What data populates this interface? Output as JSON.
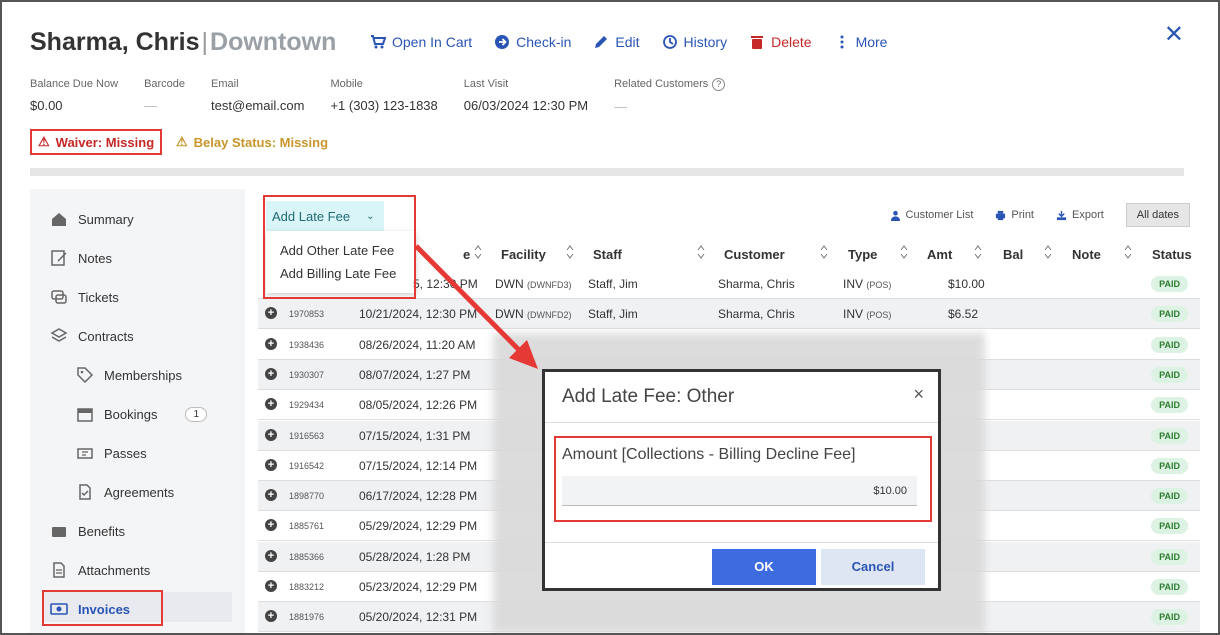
{
  "customer": {
    "name": "Sharma, Chris",
    "separator": "|",
    "location": "Downtown"
  },
  "actions": [
    {
      "label": "Open In Cart",
      "icon": "cart-icon"
    },
    {
      "label": "Check-in",
      "icon": "arrow-circle-icon"
    },
    {
      "label": "Edit",
      "icon": "pencil-icon"
    },
    {
      "label": "History",
      "icon": "history-icon"
    },
    {
      "label": "Delete",
      "icon": "trash-icon"
    },
    {
      "label": "More",
      "icon": "more-vertical-icon"
    }
  ],
  "close_label": "✕",
  "info": {
    "balance_label": "Balance Due Now",
    "balance_value": "$0.00",
    "barcode_label": "Barcode",
    "barcode_value": "—",
    "email_label": "Email",
    "email_value": "test@email.com",
    "mobile_label": "Mobile",
    "mobile_value": "+1 (303) 123-1838",
    "last_visit_label": "Last Visit",
    "last_visit_value": "06/03/2024 12:30 PM",
    "related_label": "Related Customers",
    "related_value": "—"
  },
  "alerts": {
    "waiver": "Waiver: Missing",
    "belay": "Belay Status: Missing"
  },
  "sidebar": {
    "items": [
      {
        "label": "Summary"
      },
      {
        "label": "Notes"
      },
      {
        "label": "Tickets"
      },
      {
        "label": "Contracts"
      },
      {
        "label": "Memberships"
      },
      {
        "label": "Bookings",
        "badge": "1"
      },
      {
        "label": "Passes"
      },
      {
        "label": "Agreements"
      },
      {
        "label": "Benefits"
      },
      {
        "label": "Attachments"
      },
      {
        "label": "Invoices"
      }
    ]
  },
  "toolbar": {
    "late_fee": "Add Late Fee",
    "dropdown": [
      "Add Other Late Fee",
      "Add Billing Late Fee"
    ],
    "customer_list": "Customer List",
    "print": "Print",
    "export": "Export",
    "all_dates": "All dates"
  },
  "table": {
    "headers": [
      "e",
      "Facility",
      "Staff",
      "Customer",
      "Type",
      "Amt",
      "Bal",
      "Note",
      "Status"
    ],
    "rows": [
      {
        "id": "",
        "date": "5, 12:30 PM",
        "facility": "DWN",
        "fcode": "(DWNFD3)",
        "staff": "Staff, Jim",
        "customer": "Sharma, Chris",
        "type": "INV",
        "tcode": "(POS)",
        "amt": "$10.00",
        "status": "PAID"
      },
      {
        "id": "1970853",
        "date": "10/21/2024, 12:30 PM",
        "facility": "DWN",
        "fcode": "(DWNFD2)",
        "staff": "Staff, Jim",
        "customer": "Sharma, Chris",
        "type": "INV",
        "tcode": "(POS)",
        "amt": "$6.52",
        "status": "PAID"
      },
      {
        "id": "1938436",
        "date": "08/26/2024, 11:20 AM",
        "status": "PAID"
      },
      {
        "id": "1930307",
        "date": "08/07/2024, 1:27 PM",
        "status": "PAID"
      },
      {
        "id": "1929434",
        "date": "08/05/2024, 12:26 PM",
        "status": "PAID"
      },
      {
        "id": "1916563",
        "date": "07/15/2024, 1:31 PM",
        "status": "PAID"
      },
      {
        "id": "1916542",
        "date": "07/15/2024, 12:14 PM",
        "status": "PAID"
      },
      {
        "id": "1898770",
        "date": "06/17/2024, 12:28 PM",
        "status": "PAID"
      },
      {
        "id": "1885761",
        "date": "05/29/2024, 12:29 PM",
        "status": "PAID"
      },
      {
        "id": "1885366",
        "date": "05/28/2024, 1:28 PM",
        "status": "PAID"
      },
      {
        "id": "1883212",
        "date": "05/23/2024, 12:29 PM",
        "status": "PAID"
      },
      {
        "id": "1881976",
        "date": "05/20/2024, 12:31 PM",
        "status": "PAID"
      }
    ]
  },
  "modal": {
    "title": "Add Late Fee: Other",
    "close": "×",
    "amount_label": "Amount [Collections - Billing Decline Fee]",
    "amount_value": "$10.00",
    "ok": "OK",
    "cancel": "Cancel"
  },
  "colors": {
    "accent": "#2a55b5",
    "danger": "#c62828",
    "warning": "#c8962a",
    "highlight": "#e53935",
    "ok_button": "#3d6be0"
  }
}
